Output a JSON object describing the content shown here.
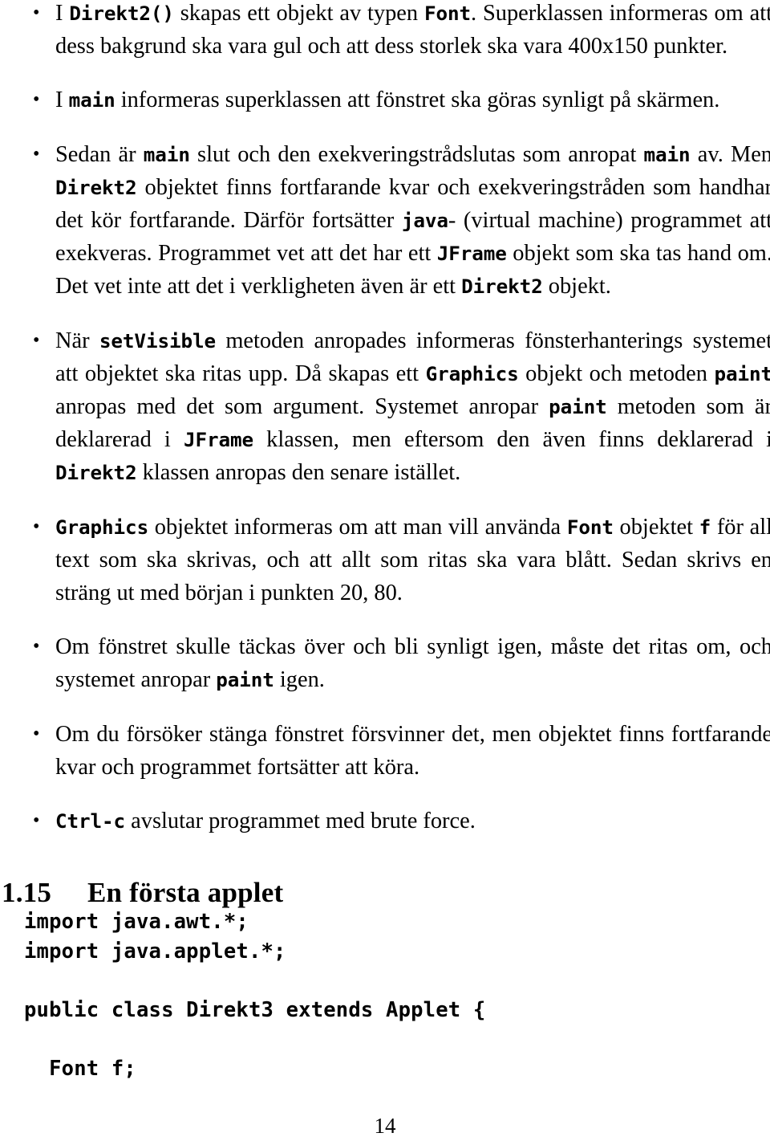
{
  "document": {
    "page_number": "14",
    "bullets": [
      {
        "id": "bullet-direkt2-constructor",
        "segments": [
          {
            "t": "text",
            "v": "I "
          },
          {
            "t": "code",
            "v": "Direkt2()"
          },
          {
            "t": "text",
            "v": " skapas ett objekt av typen "
          },
          {
            "t": "code",
            "v": "Font"
          },
          {
            "t": "text",
            "v": ". Superklassen informeras om att dess bakgrund ska vara gul och att dess storlek ska vara 400x150 punkter."
          }
        ]
      },
      {
        "id": "bullet-main-setvisible",
        "segments": [
          {
            "t": "text",
            "v": "I "
          },
          {
            "t": "code",
            "v": "main"
          },
          {
            "t": "text",
            "v": " informeras superklassen att fönstret ska göras synligt på skärmen."
          }
        ]
      },
      {
        "id": "bullet-main-thread",
        "segments": [
          {
            "t": "text",
            "v": "Sedan är "
          },
          {
            "t": "code",
            "v": "main"
          },
          {
            "t": "text",
            "v": " slut och den exekveringstrådslutas som anropat "
          },
          {
            "t": "code",
            "v": "main"
          },
          {
            "t": "text",
            "v": " av. Men "
          },
          {
            "t": "code",
            "v": "Direkt2"
          },
          {
            "t": "text",
            "v": " objektet finns fortfarande kvar och exekveringstråden som handhar det kör fortfarande. Därför fortsätter "
          },
          {
            "t": "code",
            "v": "java"
          },
          {
            "t": "text",
            "v": "- (virtual machine) programmet att exekveras. Programmet vet att det har ett "
          },
          {
            "t": "code",
            "v": "JFrame"
          },
          {
            "t": "text",
            "v": " objekt som ska tas hand om. Det vet inte att det i verkligheten även är ett "
          },
          {
            "t": "code",
            "v": "Direkt2"
          },
          {
            "t": "text",
            "v": " objekt."
          }
        ]
      },
      {
        "id": "bullet-setvisible-paint",
        "segments": [
          {
            "t": "text",
            "v": "När "
          },
          {
            "t": "code",
            "v": "setVisible"
          },
          {
            "t": "text",
            "v": " metoden anropades informeras fönsterhanterings systemet att objektet ska ritas upp. Då skapas ett "
          },
          {
            "t": "code",
            "v": "Graphics"
          },
          {
            "t": "text",
            "v": " objekt och metoden "
          },
          {
            "t": "code",
            "v": "paint"
          },
          {
            "t": "text",
            "v": " anropas med det som argument. Systemet anropar "
          },
          {
            "t": "code",
            "v": "paint"
          },
          {
            "t": "text",
            "v": " metoden som är deklarerad i "
          },
          {
            "t": "code",
            "v": "JFrame"
          },
          {
            "t": "text",
            "v": " klassen, men eftersom den även finns deklarerad i "
          },
          {
            "t": "code",
            "v": "Direkt2"
          },
          {
            "t": "text",
            "v": " klassen anropas den senare istället."
          }
        ]
      },
      {
        "id": "bullet-graphics-font",
        "segments": [
          {
            "t": "code",
            "v": "Graphics"
          },
          {
            "t": "text",
            "v": " objektet informeras om att man vill använda "
          },
          {
            "t": "code",
            "v": "Font"
          },
          {
            "t": "text",
            "v": " objektet "
          },
          {
            "t": "code",
            "v": "f"
          },
          {
            "t": "text",
            "v": " för all text som ska skrivas, och att allt som ritas ska vara blått. Sedan skrivs en sträng ut med början i punkten 20, 80."
          }
        ]
      },
      {
        "id": "bullet-repaint",
        "segments": [
          {
            "t": "text",
            "v": "Om fönstret skulle täckas över och bli synligt igen, måste det ritas om, och systemet anropar "
          },
          {
            "t": "code",
            "v": "paint"
          },
          {
            "t": "text",
            "v": " igen."
          }
        ]
      },
      {
        "id": "bullet-close-window",
        "segments": [
          {
            "t": "text",
            "v": "Om du försöker stänga fönstret försvinner det, men objektet finns fortfarande kvar och programmet fortsätter att köra."
          }
        ]
      },
      {
        "id": "bullet-ctrl-c",
        "segments": [
          {
            "t": "code",
            "v": "Ctrl-c"
          },
          {
            "t": "text",
            "v": " avslutar programmet med brute force."
          }
        ]
      }
    ],
    "section": {
      "number": "1.15",
      "title": "En första applet"
    },
    "code_block": "import java.awt.*;\nimport java.applet.*;\n\npublic class Direkt3 extends Applet {\n\n  Font f;"
  }
}
